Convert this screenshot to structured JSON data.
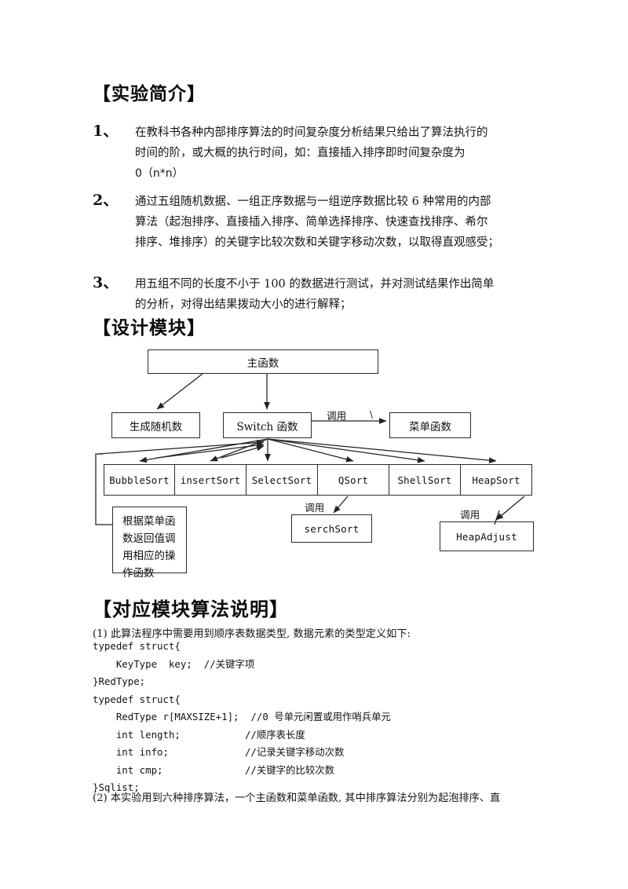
{
  "document": {
    "sections": [
      {
        "heading": "【实验简介】",
        "items": [
          {
            "marker": "1、",
            "lines": [
              "在教科书各种内部排序算法的时间复杂度分析结果只给出了算法执行的",
              "时间的阶，或大概的执行时间，如：直接插入排序即时间复杂度为",
              "0（n*n）"
            ]
          },
          {
            "marker": "2、",
            "lines": [
              "通过五组随机数据、一组正序数据与一组逆序数据比较 6 种常用的内部",
              "算法（起泡排序、直接插入排序、简单选择排序、快速查找排序、希尔",
              "排序、堆排序）的关键字比较次数和关键字移动次数，以取得直观感受；"
            ]
          },
          {
            "marker": "3、",
            "lines": [
              "用五组不同的长度不小于 100 的数据进行测试，并对测试结果作出简单",
              "的分析，对得出结果拨动大小的进行解释；"
            ]
          }
        ]
      }
    ],
    "design_heading": "【设计模块】",
    "algorithm_heading": "【对应模块算法说明】"
  },
  "diagram": {
    "main_function": "主函数",
    "random_generator": "生成随机数",
    "switch_function": "Switch 函数",
    "menu_function": "菜单函数",
    "call_label": "调用",
    "call_label_switch_to_menu": "调用",
    "call_label_qsort": "调用",
    "call_label_heap": "调用",
    "backslash_tick": "\\",
    "sorts": [
      "BubbleSort",
      "insertSort",
      "SelectSort",
      "QSort",
      "ShellSort",
      "HeapSort"
    ],
    "serch_sort": "serchSort",
    "heap_adjust": "HeapAdjust",
    "note_box": "根据菜单函数返回值调用相应的操作函数",
    "note_box_lines": [
      "根据菜单函",
      "数返回值调",
      "用相应的操",
      "作函数"
    ],
    "line_color": "#2a2a2a"
  },
  "algorithm_section": {
    "note1": "(1) 此算法程序中需要用到顺序表数据类型, 数据元素的类型定义如下:",
    "code1": "typedef struct{\n    KeyType  key;  //关键字项\n}RedType;\ntypedef struct{\n    RedType r[MAXSIZE+1];  //0 号单元闲置或用作哨兵单元\n    int length;           //顺序表长度\n    int info;             //记录关键字移动次数\n    int cmp;              //关键字的比较次数\n}Sqlist;",
    "note2": "(2) 本实验用到六种排序算法，一个主函数和菜单函数, 其中排序算法分别为起泡排序、直"
  }
}
